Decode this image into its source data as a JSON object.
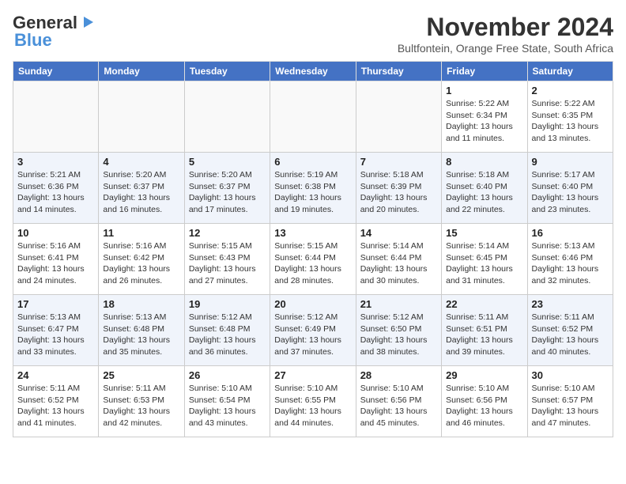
{
  "header": {
    "logo_line1": "General",
    "logo_line2": "Blue",
    "month": "November 2024",
    "subtitle": "Bultfontein, Orange Free State, South Africa"
  },
  "weekdays": [
    "Sunday",
    "Monday",
    "Tuesday",
    "Wednesday",
    "Thursday",
    "Friday",
    "Saturday"
  ],
  "weeks": [
    [
      {
        "day": "",
        "info": ""
      },
      {
        "day": "",
        "info": ""
      },
      {
        "day": "",
        "info": ""
      },
      {
        "day": "",
        "info": ""
      },
      {
        "day": "",
        "info": ""
      },
      {
        "day": "1",
        "info": "Sunrise: 5:22 AM\nSunset: 6:34 PM\nDaylight: 13 hours and 11 minutes."
      },
      {
        "day": "2",
        "info": "Sunrise: 5:22 AM\nSunset: 6:35 PM\nDaylight: 13 hours and 13 minutes."
      }
    ],
    [
      {
        "day": "3",
        "info": "Sunrise: 5:21 AM\nSunset: 6:36 PM\nDaylight: 13 hours and 14 minutes."
      },
      {
        "day": "4",
        "info": "Sunrise: 5:20 AM\nSunset: 6:37 PM\nDaylight: 13 hours and 16 minutes."
      },
      {
        "day": "5",
        "info": "Sunrise: 5:20 AM\nSunset: 6:37 PM\nDaylight: 13 hours and 17 minutes."
      },
      {
        "day": "6",
        "info": "Sunrise: 5:19 AM\nSunset: 6:38 PM\nDaylight: 13 hours and 19 minutes."
      },
      {
        "day": "7",
        "info": "Sunrise: 5:18 AM\nSunset: 6:39 PM\nDaylight: 13 hours and 20 minutes."
      },
      {
        "day": "8",
        "info": "Sunrise: 5:18 AM\nSunset: 6:40 PM\nDaylight: 13 hours and 22 minutes."
      },
      {
        "day": "9",
        "info": "Sunrise: 5:17 AM\nSunset: 6:40 PM\nDaylight: 13 hours and 23 minutes."
      }
    ],
    [
      {
        "day": "10",
        "info": "Sunrise: 5:16 AM\nSunset: 6:41 PM\nDaylight: 13 hours and 24 minutes."
      },
      {
        "day": "11",
        "info": "Sunrise: 5:16 AM\nSunset: 6:42 PM\nDaylight: 13 hours and 26 minutes."
      },
      {
        "day": "12",
        "info": "Sunrise: 5:15 AM\nSunset: 6:43 PM\nDaylight: 13 hours and 27 minutes."
      },
      {
        "day": "13",
        "info": "Sunrise: 5:15 AM\nSunset: 6:44 PM\nDaylight: 13 hours and 28 minutes."
      },
      {
        "day": "14",
        "info": "Sunrise: 5:14 AM\nSunset: 6:44 PM\nDaylight: 13 hours and 30 minutes."
      },
      {
        "day": "15",
        "info": "Sunrise: 5:14 AM\nSunset: 6:45 PM\nDaylight: 13 hours and 31 minutes."
      },
      {
        "day": "16",
        "info": "Sunrise: 5:13 AM\nSunset: 6:46 PM\nDaylight: 13 hours and 32 minutes."
      }
    ],
    [
      {
        "day": "17",
        "info": "Sunrise: 5:13 AM\nSunset: 6:47 PM\nDaylight: 13 hours and 33 minutes."
      },
      {
        "day": "18",
        "info": "Sunrise: 5:13 AM\nSunset: 6:48 PM\nDaylight: 13 hours and 35 minutes."
      },
      {
        "day": "19",
        "info": "Sunrise: 5:12 AM\nSunset: 6:48 PM\nDaylight: 13 hours and 36 minutes."
      },
      {
        "day": "20",
        "info": "Sunrise: 5:12 AM\nSunset: 6:49 PM\nDaylight: 13 hours and 37 minutes."
      },
      {
        "day": "21",
        "info": "Sunrise: 5:12 AM\nSunset: 6:50 PM\nDaylight: 13 hours and 38 minutes."
      },
      {
        "day": "22",
        "info": "Sunrise: 5:11 AM\nSunset: 6:51 PM\nDaylight: 13 hours and 39 minutes."
      },
      {
        "day": "23",
        "info": "Sunrise: 5:11 AM\nSunset: 6:52 PM\nDaylight: 13 hours and 40 minutes."
      }
    ],
    [
      {
        "day": "24",
        "info": "Sunrise: 5:11 AM\nSunset: 6:52 PM\nDaylight: 13 hours and 41 minutes."
      },
      {
        "day": "25",
        "info": "Sunrise: 5:11 AM\nSunset: 6:53 PM\nDaylight: 13 hours and 42 minutes."
      },
      {
        "day": "26",
        "info": "Sunrise: 5:10 AM\nSunset: 6:54 PM\nDaylight: 13 hours and 43 minutes."
      },
      {
        "day": "27",
        "info": "Sunrise: 5:10 AM\nSunset: 6:55 PM\nDaylight: 13 hours and 44 minutes."
      },
      {
        "day": "28",
        "info": "Sunrise: 5:10 AM\nSunset: 6:56 PM\nDaylight: 13 hours and 45 minutes."
      },
      {
        "day": "29",
        "info": "Sunrise: 5:10 AM\nSunset: 6:56 PM\nDaylight: 13 hours and 46 minutes."
      },
      {
        "day": "30",
        "info": "Sunrise: 5:10 AM\nSunset: 6:57 PM\nDaylight: 13 hours and 47 minutes."
      }
    ]
  ]
}
